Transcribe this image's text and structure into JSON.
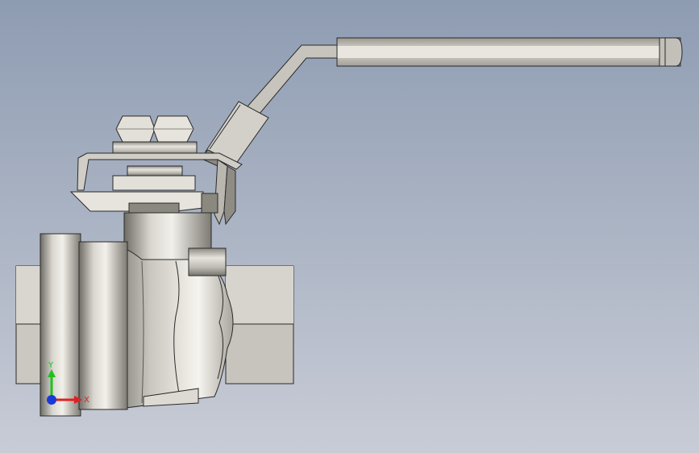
{
  "viewport": {
    "background_top": "#8f9db3",
    "background_bottom": "#c7ccd6"
  },
  "model": {
    "body_color": "#c4c2ba",
    "dark_metal": "#6b6a64",
    "edge_color": "#2a2a2a"
  },
  "triad": {
    "x_label": "X",
    "y_label": "Y",
    "x_color": "#e02020",
    "y_color": "#20c020",
    "z_color": "#1a3ad8"
  }
}
